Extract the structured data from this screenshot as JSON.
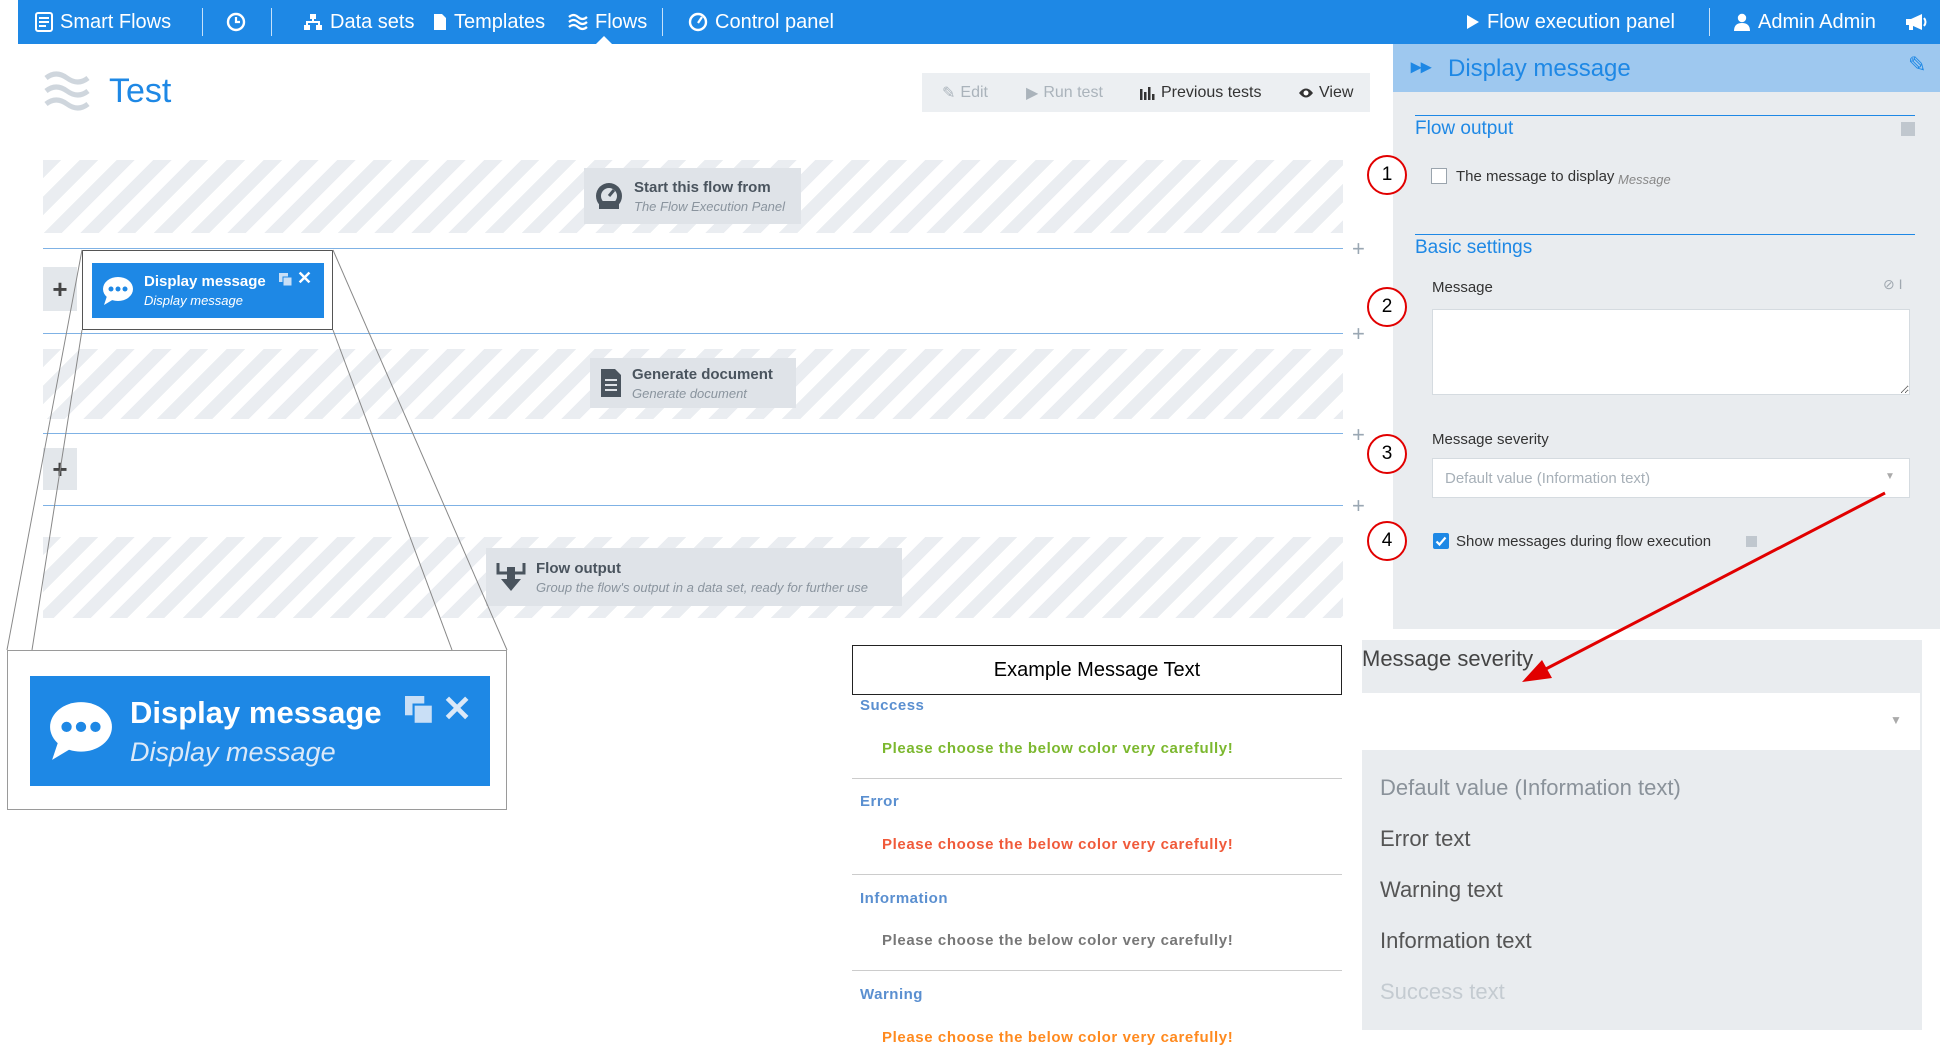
{
  "nav": {
    "brand": "Smart Flows",
    "data_sets": "Data sets",
    "templates": "Templates",
    "flows": "Flows",
    "control_panel": "Control panel",
    "flow_execution_panel": "Flow execution panel",
    "user": "Admin Admin"
  },
  "page": {
    "title": "Test"
  },
  "toolbar": {
    "edit": "Edit",
    "run_test": "Run test",
    "previous_tests": "Previous tests",
    "view": "View"
  },
  "flow": {
    "start": {
      "title": "Start this flow from",
      "subtitle": "The Flow Execution Panel"
    },
    "display_message": {
      "title": "Display message",
      "subtitle": "Display message"
    },
    "generate_document": {
      "title": "Generate document",
      "subtitle": "Generate document"
    },
    "flow_output": {
      "title": "Flow output",
      "subtitle": "Group the flow's output in a data set, ready for further use"
    }
  },
  "panel": {
    "title": "Display message",
    "flow_output_section": "Flow output",
    "message_to_display": "The message to display",
    "message_to_display_hint": "Message",
    "basic_settings": "Basic settings",
    "message_label": "Message",
    "message_value": "",
    "severity_label": "Message severity",
    "severity_value": "Default value (Information text)",
    "show_messages_label": "Show messages during flow execution",
    "show_messages_checked": true,
    "message_to_display_checked": false
  },
  "annotations": [
    "1",
    "2",
    "3",
    "4"
  ],
  "zoom": {
    "title": "Display message",
    "subtitle": "Display message"
  },
  "example": {
    "title": "Example Message Text",
    "items": [
      {
        "type": "Success",
        "text": "Please choose the below color very carefully!",
        "color": "#7cb82f"
      },
      {
        "type": "Error",
        "text": "Please choose the below color very carefully!",
        "color": "#f05a3a"
      },
      {
        "type": "Information",
        "text": "Please choose the below color very carefully!",
        "color": "#777777"
      },
      {
        "type": "Warning",
        "text": "Please choose the below color very carefully!",
        "color": "#ff8a1f"
      }
    ]
  },
  "dropdown": {
    "label": "Message severity",
    "options": [
      "Default value (Information text)",
      "Error text",
      "Warning text",
      "Information text",
      "Success text"
    ]
  },
  "colors": {
    "primary": "#1e88e5",
    "panel_bg": "#e9ecef",
    "annotation_red": "#e10000"
  }
}
